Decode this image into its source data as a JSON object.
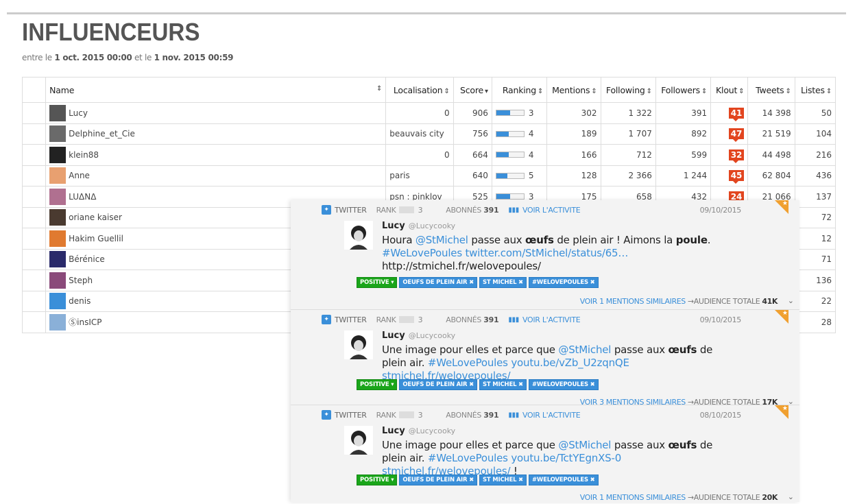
{
  "page": {
    "title": "INFLUENCEURS",
    "date_prefix": "entre le",
    "date_start": "1 oct. 2015 00:00",
    "date_mid": "et le",
    "date_end": "1 nov. 2015 00:59"
  },
  "table": {
    "columns": {
      "name": "Name",
      "location": "Localisation",
      "score": "Score",
      "ranking": "Ranking",
      "mentions": "Mentions",
      "following": "Following",
      "followers": "Followers",
      "klout": "Klout",
      "tweets": "Tweets",
      "lists": "Listes"
    },
    "sort_icon": "⇕",
    "active_sort_icon": "▾",
    "rows": [
      {
        "name": "Lucy",
        "location": "0",
        "score": "906",
        "rank": "3",
        "rank_fill": 0.5,
        "mentions": "302",
        "following": "1 322",
        "followers": "391",
        "klout": "41",
        "tweets": "14 398",
        "lists": "50",
        "avatar_color": "#555"
      },
      {
        "name": "Delphine_et_Cie",
        "location": "beauvais city",
        "score": "756",
        "rank": "4",
        "rank_fill": 0.45,
        "mentions": "189",
        "following": "1 707",
        "followers": "892",
        "klout": "47",
        "tweets": "21 519",
        "lists": "104",
        "avatar_color": "#6a6a6a"
      },
      {
        "name": "klein88",
        "location": "0",
        "score": "664",
        "rank": "4",
        "rank_fill": 0.45,
        "mentions": "166",
        "following": "712",
        "followers": "599",
        "klout": "32",
        "tweets": "44 498",
        "lists": "216",
        "avatar_color": "#222"
      },
      {
        "name": "Anne",
        "location": "paris",
        "score": "640",
        "rank": "5",
        "rank_fill": 0.4,
        "mentions": "128",
        "following": "2 366",
        "followers": "1 244",
        "klout": "45",
        "tweets": "62 804",
        "lists": "436",
        "avatar_color": "#e8a070"
      },
      {
        "name": "LUΔNΔ",
        "location": "psn : pinklov",
        "score": "525",
        "rank": "3",
        "rank_fill": 0.5,
        "mentions": "175",
        "following": "658",
        "followers": "432",
        "klout": "24",
        "tweets": "21 066",
        "lists": "137",
        "avatar_color": "#b07090"
      },
      {
        "name": "oriane kaiser",
        "location": "",
        "score": "",
        "rank": "",
        "rank_fill": 0,
        "mentions": "",
        "following": "",
        "followers": "",
        "klout": "",
        "tweets": "",
        "lists": "72",
        "avatar_color": "#4a3a30"
      },
      {
        "name": "Hakim Guellil",
        "location": "",
        "score": "",
        "rank": "",
        "rank_fill": 0,
        "mentions": "",
        "following": "",
        "followers": "",
        "klout": "",
        "tweets": "",
        "lists": "12",
        "avatar_color": "#e07a30"
      },
      {
        "name": "Bérénice",
        "location": "",
        "score": "",
        "rank": "",
        "rank_fill": 0,
        "mentions": "",
        "following": "",
        "followers": "",
        "klout": "",
        "tweets": "",
        "lists": "71",
        "avatar_color": "#2a2a6a"
      },
      {
        "name": "Steph",
        "location": "",
        "score": "",
        "rank": "",
        "rank_fill": 0,
        "mentions": "",
        "following": "",
        "followers": "",
        "klout": "",
        "tweets": "",
        "lists": "136",
        "avatar_color": "#8a4a7a"
      },
      {
        "name": "denis",
        "location": "",
        "score": "",
        "rank": "",
        "rank_fill": 0,
        "mentions": "",
        "following": "",
        "followers": "",
        "klout": "",
        "tweets": "",
        "lists": "22",
        "avatar_color": "#3a8fd9"
      },
      {
        "name": "ⓈinsICP",
        "location": "",
        "score": "",
        "rank": "",
        "rank_fill": 0,
        "mentions": "",
        "following": "",
        "followers": "",
        "klout": "",
        "tweets": "",
        "lists": "28",
        "avatar_color": "#8ab0d8"
      }
    ]
  },
  "tweets": [
    {
      "source": "TWITTER",
      "rank_label": "RANK",
      "rank_value": "3",
      "subs_label": "ABONNÉS",
      "subs_value": "391",
      "activity_label": "VOIR L'ACTIVITE",
      "date": "09/10/2015",
      "author": "Lucy",
      "handle": "@Lucycooky",
      "text_html": "Houra <span class='lk'>@StMichel</span> passe aux <b>œufs</b> de plein air ! Aimons la <b>poule</b>.<br><span class='lk'>#WeLovePoules twitter.com/StMichel/status/65…</span><br>http://stmichel.fr/welovepoules/",
      "sentiment": "POSITIVE ▾",
      "tags": [
        "OEUFS DE PLEIN AIR ✖",
        "ST MICHEL ✖",
        "#WELOVEPOULES ✖"
      ],
      "similar": "VOIR 1 MENTIONS SIMILAIRES",
      "audience_label": "→AUDIENCE TOTALE",
      "audience": "41K"
    },
    {
      "source": "TWITTER",
      "rank_label": "RANK",
      "rank_value": "3",
      "subs_label": "ABONNÉS",
      "subs_value": "391",
      "activity_label": "VOIR L'ACTIVITE",
      "date": "09/10/2015",
      "author": "Lucy",
      "handle": "@Lucycooky",
      "text_html": "Une image pour elles et parce que <span class='lk'>@StMichel</span> passe aux <b>œufs</b> de plein air. <span class='lk'>#WeLovePoules youtu.be/vZb_U2zqnQE stmichel.fr/welovepoules/</span>",
      "sentiment": "POSITIVE ▾",
      "tags": [
        "OEUFS DE PLEIN AIR ✖",
        "ST MICHEL ✖",
        "#WELOVEPOULES ✖"
      ],
      "similar": "VOIR 3 MENTIONS SIMILAIRES",
      "audience_label": "→AUDIENCE TOTALE",
      "audience": "17K"
    },
    {
      "source": "TWITTER",
      "rank_label": "RANK",
      "rank_value": "3",
      "subs_label": "ABONNÉS",
      "subs_value": "391",
      "activity_label": "VOIR L'ACTIVITE",
      "date": "08/10/2015",
      "author": "Lucy",
      "handle": "@Lucycooky",
      "text_html": "Une image pour elles et parce que <span class='lk'>@StMichel</span> passe aux <b>œufs</b> de plein air. <span class='lk'>#WeLovePoules youtu.be/TctYEgnXS-0 stmichel.fr/welovepoules/</span> !",
      "sentiment": "POSITIVE ▾",
      "tags": [
        "OEUFS DE PLEIN AIR ✖",
        "ST MICHEL ✖",
        "#WELOVEPOULES ✖"
      ],
      "similar": "VOIR 1 MENTIONS SIMILAIRES",
      "audience_label": "→AUDIENCE TOTALE",
      "audience": "20K"
    }
  ],
  "colors": {
    "accent": "#3a8fd9",
    "klout": "#e2451f",
    "positive": "#1aa51a"
  }
}
